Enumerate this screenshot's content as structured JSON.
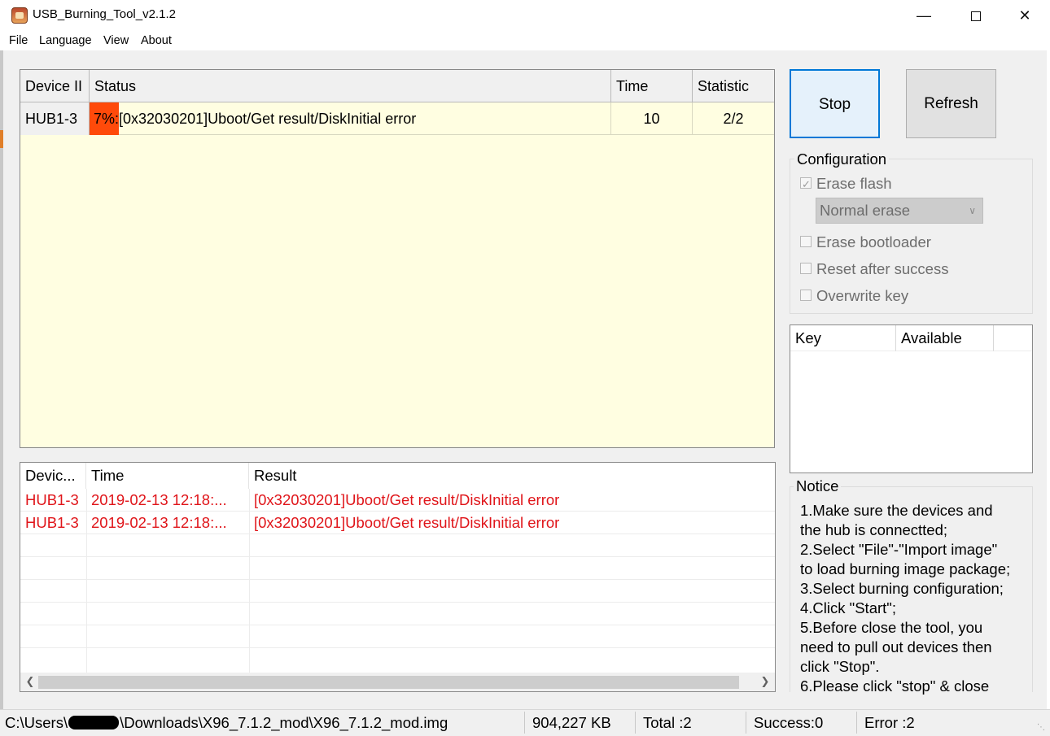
{
  "window": {
    "title": "USB_Burning_Tool_v2.1.2"
  },
  "menu": [
    "File",
    "Language",
    "View",
    "About"
  ],
  "device_table": {
    "headers": [
      "Device II",
      "Status",
      "Time",
      "Statistic"
    ],
    "rows": [
      {
        "id": "HUB1-3",
        "progress": 7,
        "status_text": "7%:[0x32030201]Uboot/Get result/DiskInitial error",
        "time": "10",
        "statistic": "2/2"
      }
    ],
    "progress_color": "#ff4a0a",
    "background": "#fffee1"
  },
  "buttons": {
    "stop": "Stop",
    "refresh": "Refresh"
  },
  "configuration": {
    "legend": "Configuration",
    "erase_flash": {
      "label": "Erase flash",
      "checked": true
    },
    "erase_mode": "Normal erase",
    "erase_bootloader": {
      "label": "Erase bootloader",
      "checked": false
    },
    "reset_after_success": {
      "label": "Reset after success",
      "checked": false
    },
    "overwrite_key": {
      "label": "Overwrite key",
      "checked": false
    }
  },
  "key_table": {
    "headers": [
      "Key",
      "Available"
    ]
  },
  "notice": {
    "legend": "Notice",
    "text": "1.Make sure the devices and\nthe hub is connectted;\n2.Select \"File\"-\"Import image\"\nto load burning image package;\n3.Select burning configuration;\n4.Click \"Start\";\n5.Before close the tool, you\nneed to pull out devices then\nclick \"Stop\".\n6.Please click \"stop\" & close"
  },
  "log_table": {
    "headers": [
      "Devic...",
      "Time",
      "Result"
    ],
    "rows": [
      {
        "device": "HUB1-3",
        "time": "2019-02-13 12:18:...",
        "result": "[0x32030201]Uboot/Get result/DiskInitial error"
      },
      {
        "device": "HUB1-3",
        "time": "2019-02-13 12:18:...",
        "result": "[0x32030201]Uboot/Get result/DiskInitial error"
      }
    ],
    "error_color": "#e0151a"
  },
  "status_bar": {
    "path_prefix": "C:\\Users\\",
    "path_suffix": "\\Downloads\\X96_7.1.2_mod\\X96_7.1.2_mod.img",
    "size": "904,227 KB",
    "total": "Total :2",
    "success": "Success:0",
    "error": "Error :2"
  }
}
